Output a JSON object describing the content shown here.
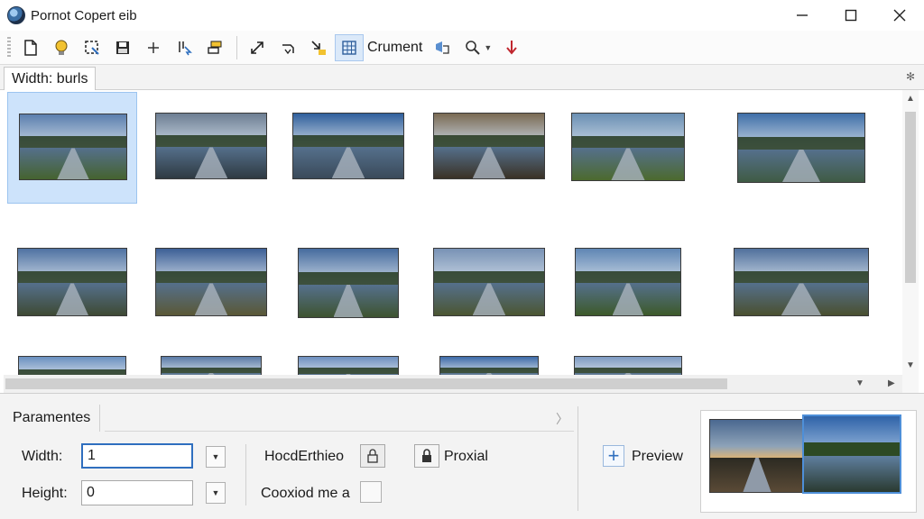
{
  "window": {
    "title": "Pornot Copert eib",
    "icon": "app-globe-icon",
    "controls": [
      "minimize-icon",
      "maximize-icon",
      "close-icon"
    ]
  },
  "toolbar": {
    "buttons": [
      {
        "name": "new-file-icon"
      },
      {
        "name": "lightbulb-icon"
      },
      {
        "name": "crop-icon"
      },
      {
        "name": "save-icon"
      },
      {
        "name": "add-icon"
      },
      {
        "name": "select-tool-icon"
      },
      {
        "name": "layers-icon"
      },
      {
        "name": "resize-icon"
      },
      {
        "name": "rotate-icon"
      },
      {
        "name": "import-icon"
      },
      {
        "name": "grid-view-icon",
        "active": true
      }
    ],
    "document_label": "Crument",
    "after_label": [
      "share-icon",
      "zoom-icon",
      "pin-icon"
    ]
  },
  "tab": {
    "label": "Width: burls"
  },
  "grid": {
    "thumbnails": [
      {
        "sky": "#5b7fae",
        "ground": "#45632f",
        "selected": true
      },
      {
        "sky": "#6d7e92",
        "ground": "#2f3a42"
      },
      {
        "sky": "#2f5f9c",
        "ground": "#3a4a5a"
      },
      {
        "sky": "#7a6a52",
        "ground": "#3a3226"
      },
      {
        "sky": "#6a8fb3",
        "ground": "#4c6a2e"
      },
      {
        "sky": "#3f6fa8",
        "ground": "#3f5b44"
      },
      {
        "sky": "#4f72a2",
        "ground": "#3e4a34"
      },
      {
        "sky": "#3c5f96",
        "ground": "#5a5836"
      },
      {
        "sky": "#456b9e",
        "ground": "#3e5430"
      },
      {
        "sky": "#7892b5",
        "ground": "#4b5632"
      },
      {
        "sky": "#5f86b4",
        "ground": "#3d5a2a"
      },
      {
        "sky": "#50709c",
        "ground": "#4a5030"
      },
      {
        "sky": "#6a90c0",
        "ground": "#ffffff"
      },
      {
        "sky": "#5a7aa6",
        "ground": "#ffffff"
      },
      {
        "sky": "#6d8fbf",
        "ground": "#ffffff"
      },
      {
        "sky": "#3d6aa8",
        "ground": "#ffffff"
      },
      {
        "sky": "#7d9ac2",
        "ground": "#ffffff"
      }
    ]
  },
  "panel": {
    "tab_label": "Paramentes",
    "width_label": "Width:",
    "width_value": "1",
    "height_label": "Height:",
    "height_value": "0",
    "option1_label": "HocdErthieo",
    "option2_label": "Proxial",
    "option3_label": "Cooxiod me a",
    "preview_label": "Preview"
  },
  "colors": {
    "accent": "#2f6fbf",
    "selection": "#cde3fb"
  }
}
